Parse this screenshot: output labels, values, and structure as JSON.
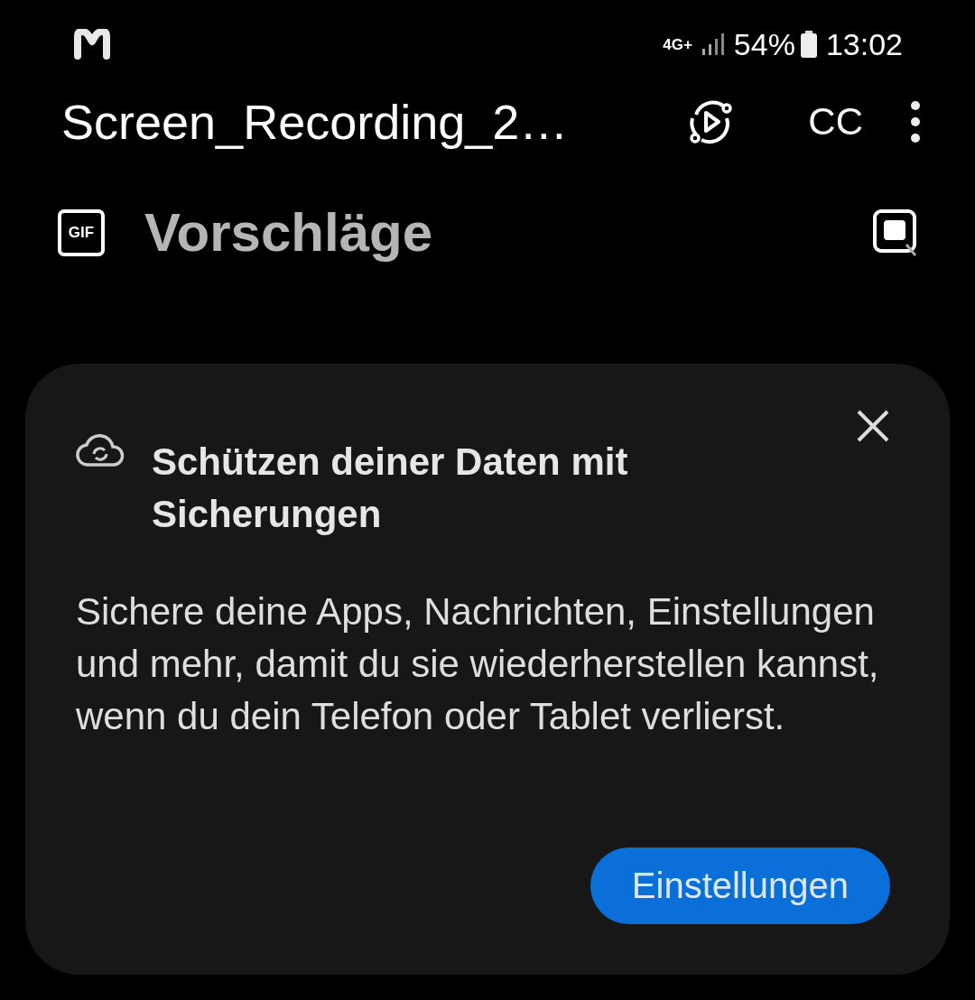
{
  "status_bar": {
    "network": "4G+",
    "battery": "54%",
    "time": "13:02"
  },
  "player_bar": {
    "title": "Screen_Recording_2…",
    "captions": "CC"
  },
  "header": {
    "title": "Vorschläge",
    "gif_label": "GIF"
  },
  "card": {
    "title": "Schützen deiner Daten mit Sicherungen",
    "body": "Sichere deine Apps, Nachrichten, Einstellungen und mehr, damit du sie wiederherstellen kannst, wenn du dein Telefon oder Tablet verlierst.",
    "button": "Einstellungen"
  }
}
